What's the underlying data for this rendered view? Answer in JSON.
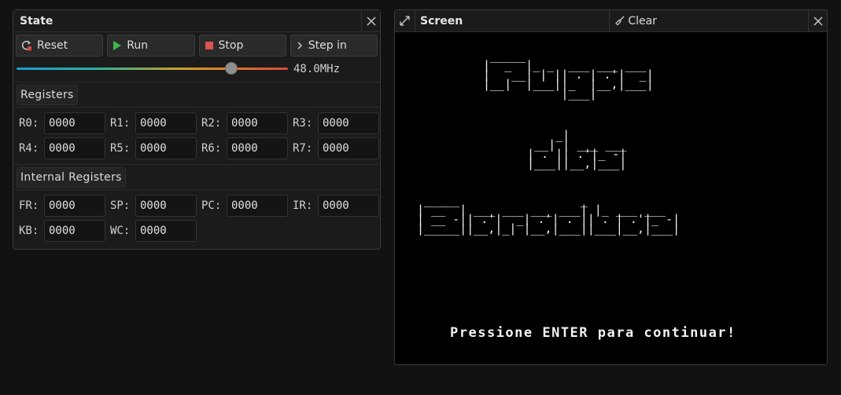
{
  "state_panel": {
    "title": "State",
    "buttons": {
      "reset": "Reset",
      "run": "Run",
      "stop": "Stop",
      "step_in": "Step in"
    },
    "clock": {
      "value_label": "48.0MHz",
      "slider_fraction": 0.79
    },
    "registers_header": "Registers",
    "registers": [
      {
        "label": "R0:",
        "value": "0000"
      },
      {
        "label": "R1:",
        "value": "0000"
      },
      {
        "label": "R2:",
        "value": "0000"
      },
      {
        "label": "R3:",
        "value": "0000"
      },
      {
        "label": "R4:",
        "value": "0000"
      },
      {
        "label": "R5:",
        "value": "0000"
      },
      {
        "label": "R6:",
        "value": "0000"
      },
      {
        "label": "R7:",
        "value": "0000"
      }
    ],
    "internal_header": "Internal Registers",
    "internal_registers": [
      {
        "label": "FR:",
        "value": "0000"
      },
      {
        "label": "SP:",
        "value": "0000"
      },
      {
        "label": "PC:",
        "value": "0000"
      },
      {
        "label": "IR:",
        "value": "0000"
      },
      {
        "label": "KB:",
        "value": "0000"
      },
      {
        "label": "WC:",
        "value": "0000"
      }
    ]
  },
  "screen_panel": {
    "title": "Screen",
    "clear_label": "Clear",
    "ascii_line1": [
      " _____",
      "|  _  |_ _  ___ ___ ___ ",
      "|   __| | || . | .'|  _|",
      "|__|  |___||_  |__,|___|",
      "           |___|"
    ],
    "ascii_line2": [
      "    _|",
      " __| | ___ ___ ",
      "| . || .'|_ -|",
      "|___||__,|___|"
    ],
    "ascii_line3": [
      " _____                 _",
      "| __  | ___ ___ ___ ___| |_ ___ ___",
      "| __ -|| .'|  _| .'| . || . | .'|_ -|",
      "|_____||__,|_| |__,|___||___|__,|___|"
    ],
    "prompt": "Pressione ENTER para continuar!"
  },
  "colors": {
    "run_icon": "#3fb54a",
    "stop_icon": "#d9534f",
    "reset_icon_dot": "#d9483b"
  }
}
